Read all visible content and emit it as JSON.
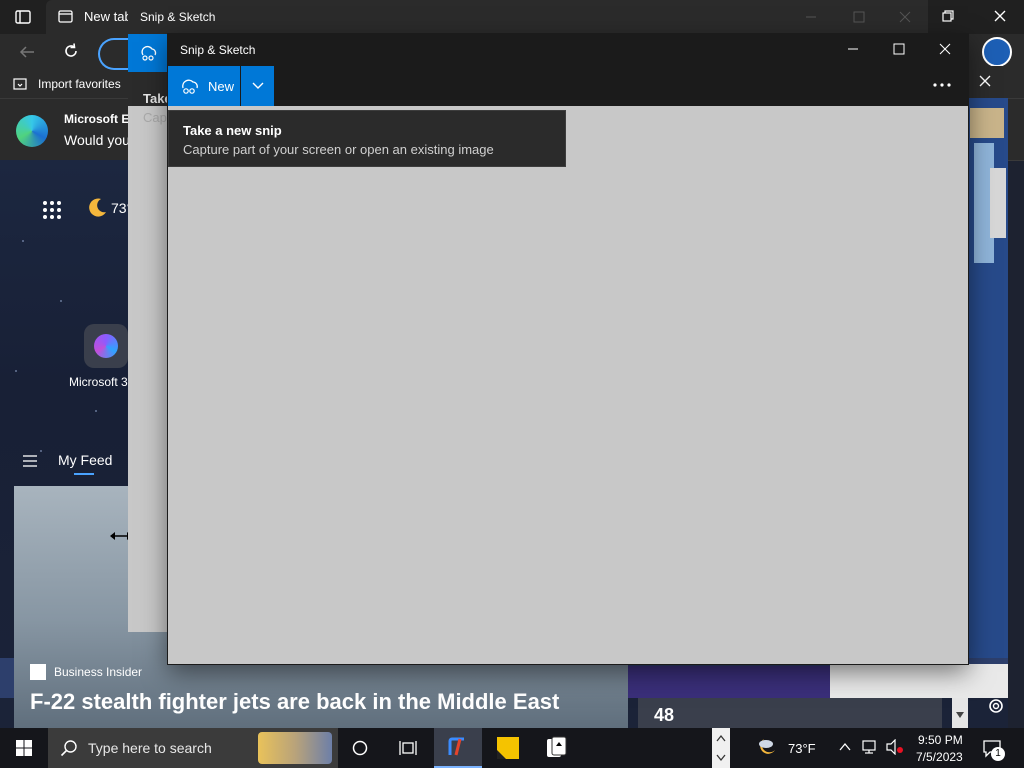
{
  "browser": {
    "tab_label": "New tab",
    "favorites_label": "Import favorites",
    "banner_title": "Microsoft E",
    "banner_text": "Would you",
    "weather_temp": "73°",
    "app_label": "Microsoft 3",
    "feed_label": "My Feed",
    "news_source": "Business Insider",
    "news_title": "F-22 stealth fighter jets are back in the Middle East",
    "widget_number": "48",
    "side_label_1": "Take",
    "side_label_2": "Cap"
  },
  "snip_bg": {
    "title": "Snip & Sketch"
  },
  "snip": {
    "title": "Snip & Sketch",
    "new_label": "New",
    "tooltip_title": "Take a new snip",
    "tooltip_text": "Capture part of your screen or open an existing image"
  },
  "taskbar": {
    "search_placeholder": "Type here to search",
    "temperature": "73°F",
    "time": "9:50 PM",
    "date": "7/5/2023",
    "notification_count": "1"
  },
  "colors": {
    "accent": "#0078d7",
    "titlebar": "#1b1b1b",
    "canvas": "#c8c8c8"
  }
}
